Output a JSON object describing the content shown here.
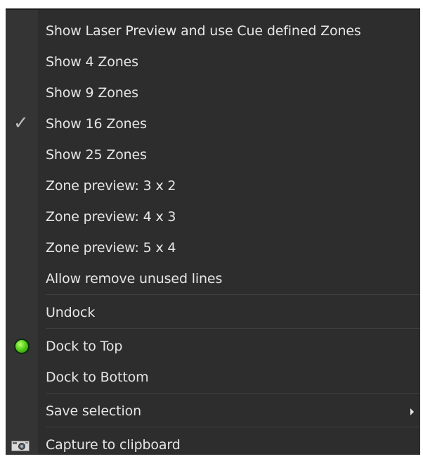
{
  "menu": {
    "items": [
      {
        "label": "Show Laser Preview and use Cue defined Zones"
      },
      {
        "label": "Show 4 Zones"
      },
      {
        "label": "Show 9 Zones"
      },
      {
        "label": "Show 16 Zones",
        "checked": true
      },
      {
        "label": "Show 25 Zones"
      },
      {
        "label": "Zone preview: 3 x 2"
      },
      {
        "label": "Zone preview: 4 x 3"
      },
      {
        "label": "Zone preview: 5 x 4"
      },
      {
        "label": "Allow remove unused lines"
      },
      {
        "label": "Undock"
      },
      {
        "label": "Dock to Top",
        "active": true
      },
      {
        "label": "Dock to Bottom"
      },
      {
        "label": "Save selection",
        "submenu": true
      },
      {
        "label": "Capture to clipboard"
      }
    ],
    "check_glyph": "✓",
    "icons": {
      "check": "checkmark-icon",
      "dock": "green-indicator-icon",
      "submenu": "submenu-arrow-icon",
      "capture": "camera-icon"
    },
    "colors": {
      "background": "#2d2d2d",
      "text": "#e6e6e6",
      "indicator": "#58d01e"
    }
  }
}
